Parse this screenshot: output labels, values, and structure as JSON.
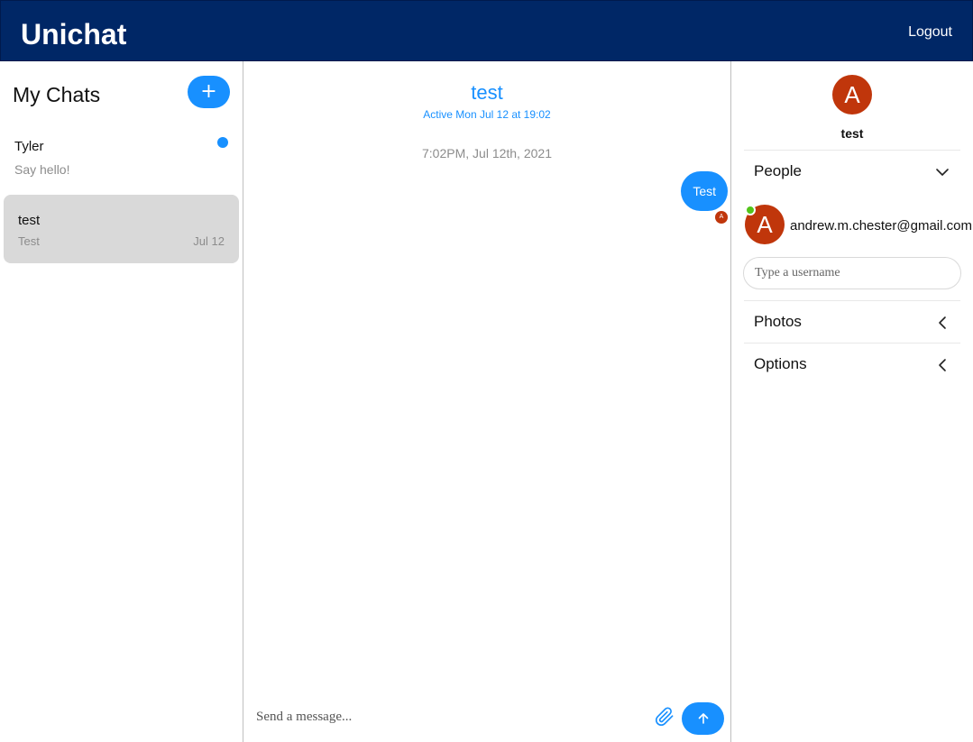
{
  "navbar": {
    "logo": "Unichat",
    "logout_label": "Logout"
  },
  "chat_list": {
    "title": "My Chats",
    "new_chat_label": "+",
    "chats": [
      {
        "title": "Tyler",
        "last_message": "Say hello!",
        "date": "",
        "unread": true
      },
      {
        "title": "test",
        "last_message": "Test",
        "date": "Jul 12",
        "selected": true
      }
    ]
  },
  "chat_feed": {
    "title": "test",
    "subtitle": "Active Mon Jul 12 at 19:02",
    "timestamp": "7:02PM, Jul 12th, 2021",
    "messages": [
      {
        "text": "Test",
        "sender_initial": "A",
        "own": true
      }
    ],
    "composer_placeholder": "Send a message..."
  },
  "chat_settings": {
    "avatar_initial": "A",
    "title": "test",
    "sections": {
      "people": "People",
      "photos": "Photos",
      "options": "Options"
    },
    "people": [
      {
        "initial": "A",
        "email": "andrew.m.chester@gmail.com",
        "online": true
      }
    ],
    "add_user_placeholder": "Type a username"
  },
  "colors": {
    "navbar": "#002766",
    "accent": "#1890ff",
    "avatar": "#c0360b",
    "online": "#52c41a",
    "selected_chat": "#d9d9d9"
  }
}
